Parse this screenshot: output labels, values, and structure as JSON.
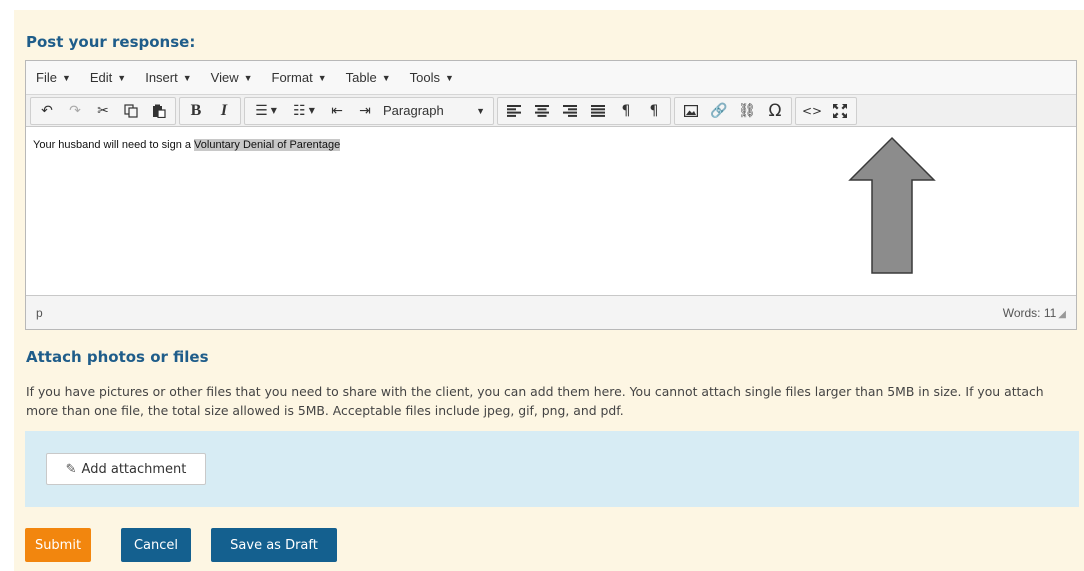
{
  "post_heading": "Post your response:",
  "editor": {
    "menus": [
      "File",
      "Edit",
      "Insert",
      "View",
      "Format",
      "Table",
      "Tools"
    ],
    "format_select": "Paragraph",
    "content_text": "Your husband will need to sign a ",
    "content_highlight": "Voluntary Denial of Parentage",
    "status_path": "p",
    "word_count": "Words: 11"
  },
  "attach": {
    "heading": "Attach photos or files",
    "description": "If you have pictures or other files that you need to share with the client, you can add them here. You cannot attach single files larger than 5MB in size. If you attach more than one file, the total size allowed is 5MB. Acceptable files include jpeg, gif, png, and pdf.",
    "button_label": "Add attachment"
  },
  "actions": {
    "submit": "Submit",
    "cancel": "Cancel",
    "draft": "Save as Draft"
  },
  "colors": {
    "panel_bg": "#fdf6e3",
    "heading": "#1f5d8a",
    "submit": "#f2860e",
    "primary": "#14608f",
    "attach_bg": "#d7ecf4",
    "arrow": "#8c8c8c"
  },
  "icons": [
    "undo-icon",
    "redo-icon",
    "cut-icon",
    "copy-icon",
    "paste-icon",
    "bullet-list-icon",
    "numbered-list-icon",
    "outdent-icon",
    "indent-icon",
    "align-left-icon",
    "align-center-icon",
    "align-right-icon",
    "justify-icon",
    "ltr-icon",
    "rtl-icon",
    "image-icon",
    "link-icon",
    "unlink-icon",
    "special-char-icon",
    "source-code-icon",
    "fullscreen-icon",
    "paperclip-icon"
  ]
}
